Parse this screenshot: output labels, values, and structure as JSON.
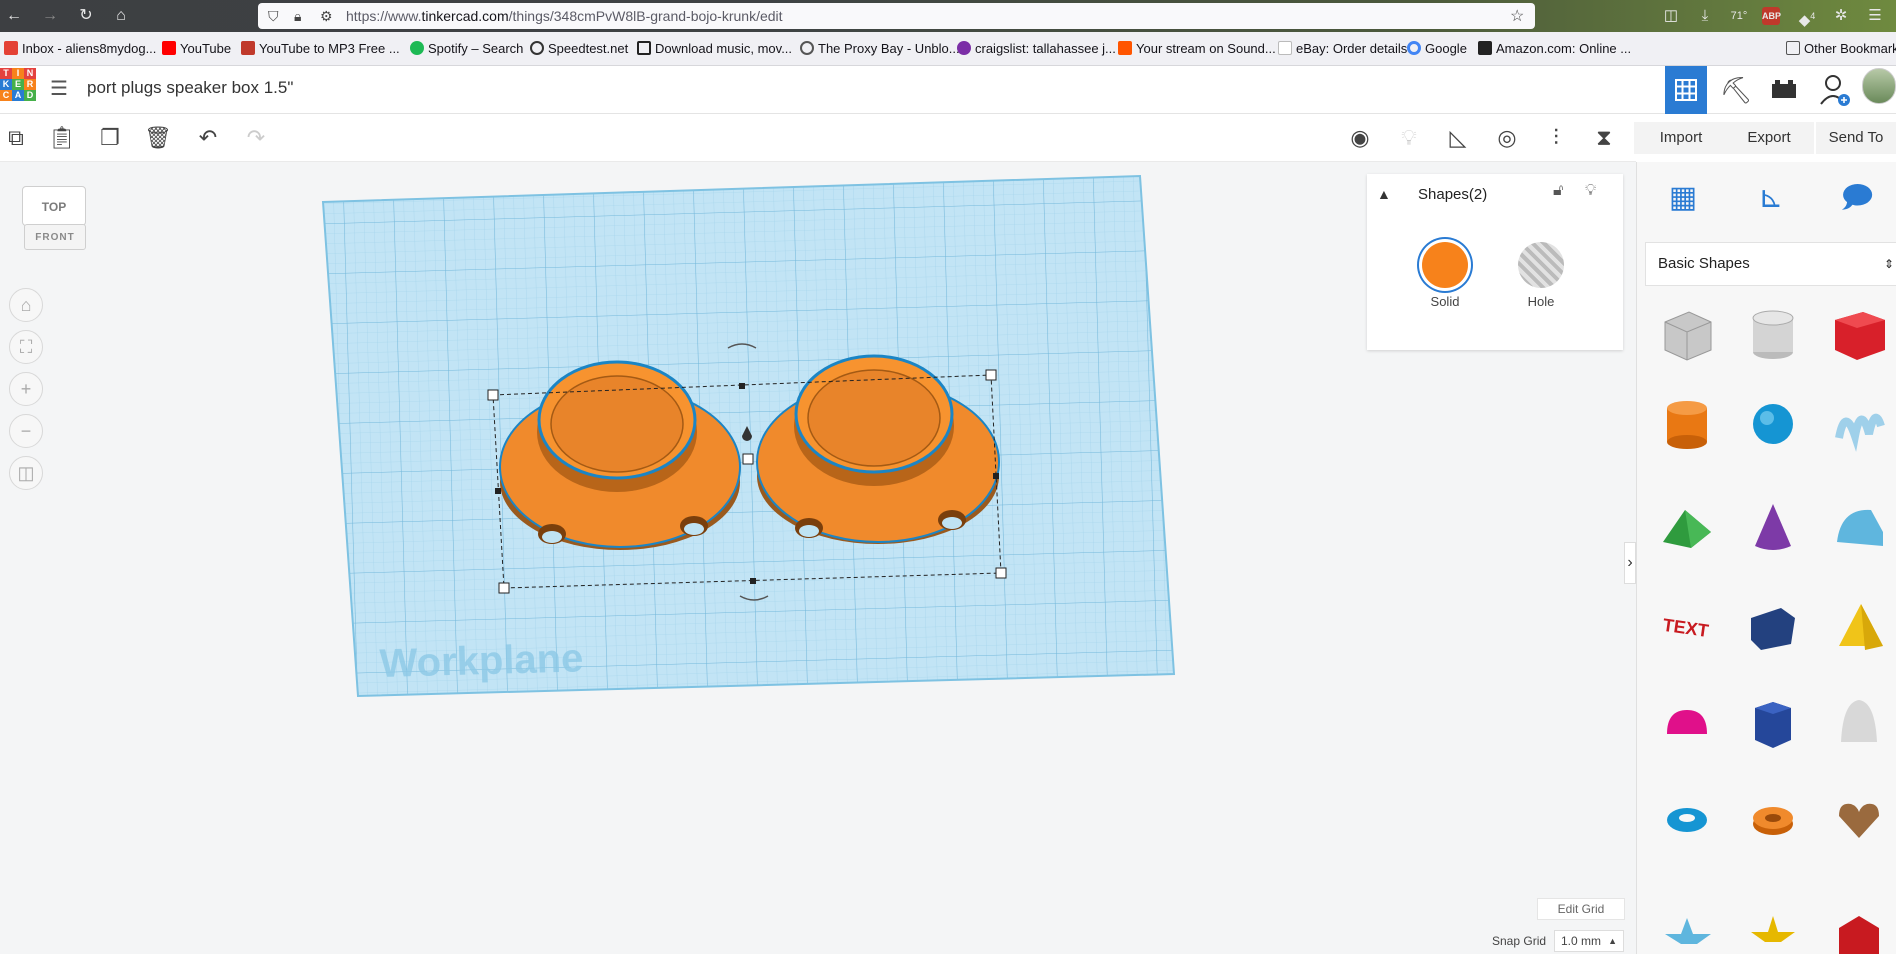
{
  "browser": {
    "url_prefix": "https://www.",
    "url_host": "tinkercad.com",
    "url_path": "/things/348cmPvW8lB-grand-bojo-krunk/edit",
    "weather": "71°",
    "notification_badge": "4"
  },
  "bookmarks": [
    {
      "label": "Inbox - aliens8mydog...",
      "color": "#e44135"
    },
    {
      "label": "YouTube",
      "color": "#ff0000"
    },
    {
      "label": "YouTube to MP3 Free ...",
      "color": "#c0392b"
    },
    {
      "label": "Spotify – Search",
      "color": "#1db954"
    },
    {
      "label": "Speedtest.net",
      "color": "#333333"
    },
    {
      "label": "Download music, mov...",
      "color": "#222222"
    },
    {
      "label": "The Proxy Bay - Unblo...",
      "color": "#555555"
    },
    {
      "label": "craigslist: tallahassee j...",
      "color": "#7b2ea6"
    },
    {
      "label": "Your stream on Sound...",
      "color": "#ff5500"
    },
    {
      "label": "eBay: Order details",
      "color": "#e53238"
    },
    {
      "label": "Google",
      "color": "#4285f4"
    },
    {
      "label": "Amazon.com: Online ...",
      "color": "#222222"
    }
  ],
  "other_bookmarks": "Other Bookmarks",
  "app": {
    "logo_letters": [
      "T",
      "I",
      "N",
      "K",
      "E",
      "R",
      "C",
      "A",
      "D"
    ],
    "title": "port plugs speaker box 1.5\"",
    "accent": "#2a7bd3"
  },
  "toolbar": {
    "import": "Import",
    "export": "Export",
    "send_to": "Send To"
  },
  "viewcube": {
    "top": "TOP",
    "front": "FRONT"
  },
  "inspector": {
    "title": "Shapes(2)",
    "solid_label": "Solid",
    "hole_label": "Hole",
    "solid_color": "#f7821b"
  },
  "workplane": {
    "label": "Workplane"
  },
  "right_panel": {
    "category": "Basic Shapes"
  },
  "grid": {
    "edit_label": "Edit Grid",
    "snap_label": "Snap Grid",
    "snap_value": "1.0 mm"
  }
}
